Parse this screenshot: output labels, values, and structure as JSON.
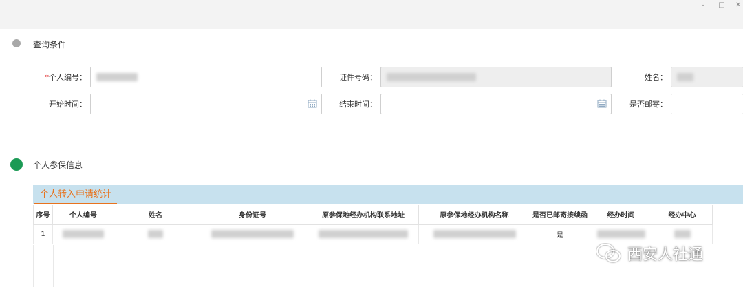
{
  "window": {
    "minimize": "–",
    "maximize": "□",
    "close": "✕"
  },
  "query_section": {
    "title": "查询条件"
  },
  "form": {
    "personal_id_required_mark": "*",
    "personal_id_label": "个人编号：",
    "cert_no_label": "证件号码：",
    "name_label": "姓名：",
    "start_time_label": "开始时间：",
    "end_time_label": "结束时间：",
    "mailed_label": "是否邮寄："
  },
  "info_section": {
    "title": "个人参保信息"
  },
  "tabs": [
    {
      "label": "个人转入申请统计",
      "active": true
    }
  ],
  "table": {
    "columns": [
      "序号",
      "个人编号",
      "姓名",
      "身份证号",
      "原参保地经办机构联系地址",
      "原参保地经办机构名称",
      "是否已邮寄接续函",
      "经办时间",
      "经办中心"
    ],
    "rows": [
      {
        "seq": "1",
        "mailed": "是"
      }
    ]
  },
  "watermark": {
    "text": "西安人社通",
    "icon": "wechat-icon"
  },
  "colors": {
    "accent_orange": "#e8731e",
    "tab_strip": "#c7e1ee",
    "timeline_green": "#1b9a55",
    "timeline_grey": "#a8a8a8"
  }
}
